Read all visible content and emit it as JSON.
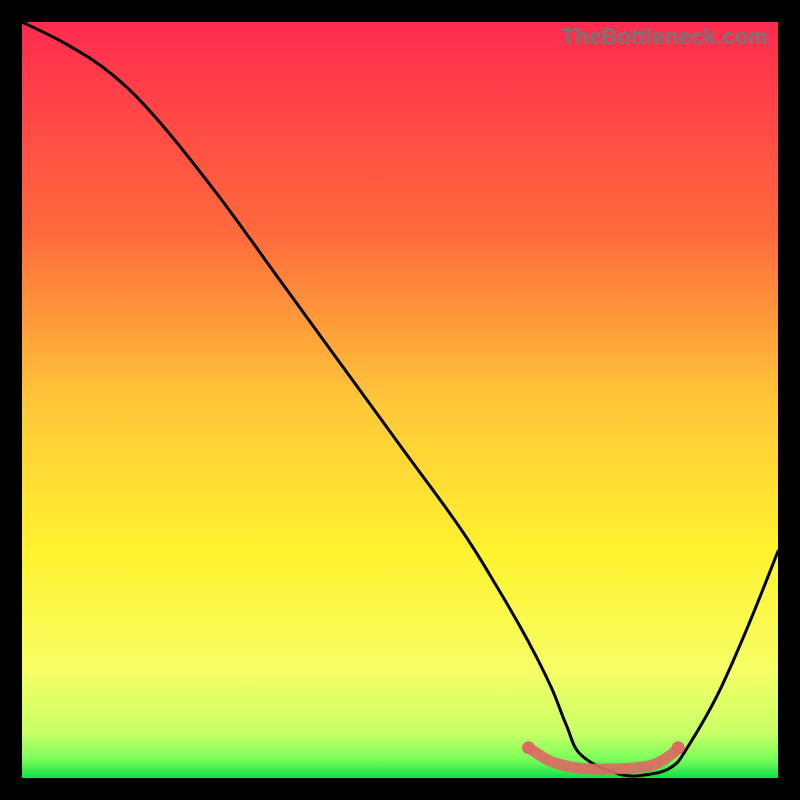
{
  "watermark": "TheBottleneck.com",
  "chart_data": {
    "type": "line",
    "title": "",
    "xlabel": "",
    "ylabel": "",
    "x_range": [
      0,
      100
    ],
    "y_range": [
      0,
      100
    ],
    "gradient_stops": [
      {
        "offset": 0,
        "color": "#ff2b4f"
      },
      {
        "offset": 0.28,
        "color": "#ff6a3c"
      },
      {
        "offset": 0.5,
        "color": "#ffc638"
      },
      {
        "offset": 0.7,
        "color": "#fff22e"
      },
      {
        "offset": 0.86,
        "color": "#f6ff66"
      },
      {
        "offset": 0.94,
        "color": "#c9ff66"
      },
      {
        "offset": 0.975,
        "color": "#7bff5a"
      },
      {
        "offset": 1.0,
        "color": "#10e049"
      }
    ],
    "series": [
      {
        "name": "curve",
        "color": "#000000",
        "x": [
          0,
          6,
          12,
          18,
          26,
          34,
          42,
          50,
          58,
          63,
          67,
          70,
          72,
          74,
          79,
          83,
          86,
          88,
          92,
          96,
          100
        ],
        "y": [
          100,
          97,
          93,
          87,
          77,
          66,
          55,
          44,
          33,
          25,
          18,
          12,
          7,
          3,
          0.5,
          0.5,
          1.5,
          4,
          11,
          20,
          30
        ]
      },
      {
        "name": "valley-band",
        "color": "#db6b63",
        "x": [
          67,
          69,
          70.5,
          72.5,
          75,
          78,
          80.5,
          83,
          84.5,
          86,
          86.8
        ],
        "y": [
          4,
          2.7,
          2,
          1.5,
          1.2,
          1.2,
          1.3,
          1.6,
          2.2,
          3.2,
          4
        ]
      }
    ]
  }
}
